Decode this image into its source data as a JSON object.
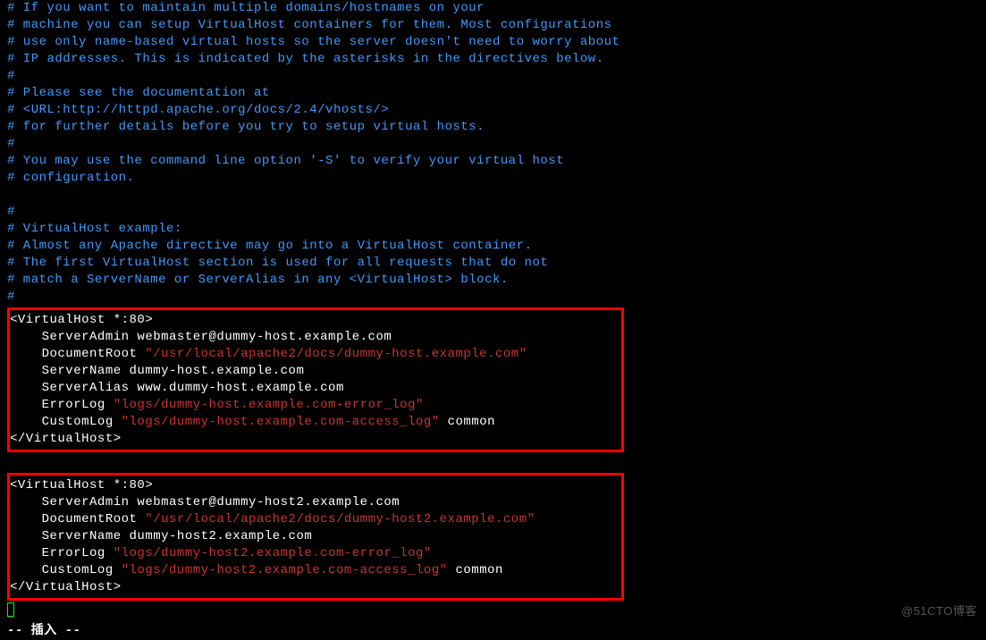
{
  "comments": {
    "l1": "# If you want to maintain multiple domains/hostnames on your",
    "l2": "# machine you can setup VirtualHost containers for them. Most configurations",
    "l3": "# use only name-based virtual hosts so the server doesn't need to worry about",
    "l4": "# IP addresses. This is indicated by the asterisks in the directives below.",
    "l5": "#",
    "l6": "# Please see the documentation at",
    "l7": "# <URL:http://httpd.apache.org/docs/2.4/vhosts/>",
    "l8": "# for further details before you try to setup virtual hosts.",
    "l9": "#",
    "l10": "# You may use the command line option '-S' to verify your virtual host",
    "l11": "# configuration.",
    "l12": "#",
    "l13": "# VirtualHost example:",
    "l14": "# Almost any Apache directive may go into a VirtualHost container.",
    "l15": "# The first VirtualHost section is used for all requests that do not",
    "l16": "# match a ServerName or ServerAlias in any <VirtualHost> block.",
    "l17": "#"
  },
  "vhost1": {
    "open": "<VirtualHost *:80>",
    "server_admin": "    ServerAdmin webmaster@dummy-host.example.com",
    "doc_root_label": "    DocumentRoot ",
    "doc_root_value": "\"/usr/local/apache2/docs/dummy-host.example.com\"",
    "server_name": "    ServerName dummy-host.example.com",
    "server_alias": "    ServerAlias www.dummy-host.example.com",
    "error_log_label": "    ErrorLog ",
    "error_log_value": "\"logs/dummy-host.example.com-error_log\"",
    "custom_log_label": "    CustomLog ",
    "custom_log_value": "\"logs/dummy-host.example.com-access_log\"",
    "custom_log_suffix": " common",
    "close": "</VirtualHost>"
  },
  "vhost2": {
    "open": "<VirtualHost *:80>",
    "server_admin": "    ServerAdmin webmaster@dummy-host2.example.com",
    "doc_root_label": "    DocumentRoot ",
    "doc_root_value": "\"/usr/local/apache2/docs/dummy-host2.example.com\"",
    "server_name": "    ServerName dummy-host2.example.com",
    "error_log_label": "    ErrorLog ",
    "error_log_value": "\"logs/dummy-host2.example.com-error_log\"",
    "custom_log_label": "    CustomLog ",
    "custom_log_value": "\"logs/dummy-host2.example.com-access_log\"",
    "custom_log_suffix": " common",
    "close": "</VirtualHost>"
  },
  "status": "-- 插入 --",
  "watermark": "@51CTO博客"
}
